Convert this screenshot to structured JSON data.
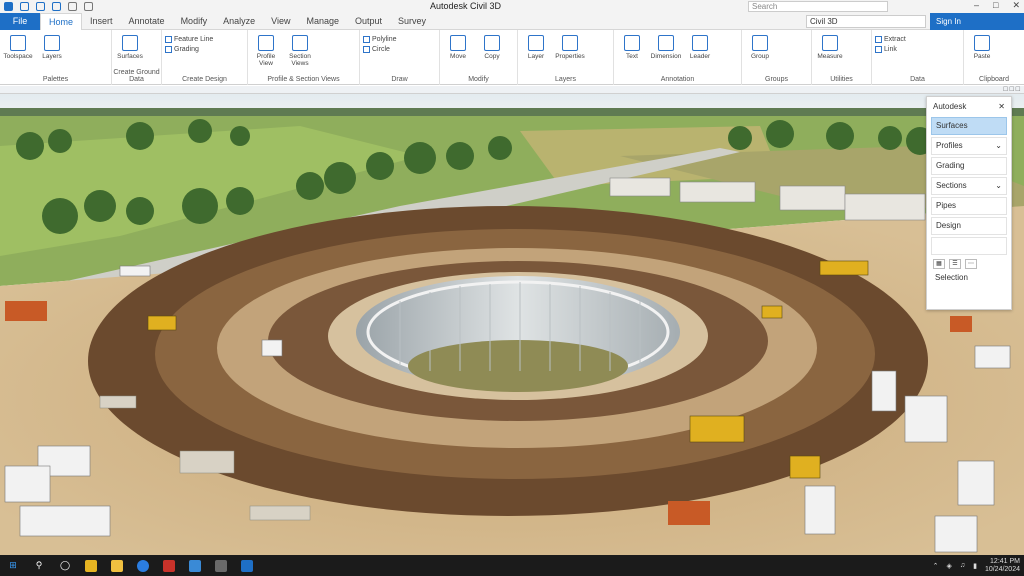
{
  "app": {
    "title": "Autodesk Civil 3D",
    "search_placeholder": "Search",
    "workspace": "Civil 3D"
  },
  "tabs": [
    {
      "label": "File"
    },
    {
      "label": "Home"
    },
    {
      "label": "Insert"
    },
    {
      "label": "Annotate"
    },
    {
      "label": "Modify"
    },
    {
      "label": "Analyze"
    },
    {
      "label": "View"
    },
    {
      "label": "Manage"
    },
    {
      "label": "Output"
    },
    {
      "label": "Survey"
    }
  ],
  "signin": "Sign In",
  "ribbon": {
    "panels": [
      {
        "label": "Palettes",
        "buttons": [
          "Toolspace",
          "Layers"
        ]
      },
      {
        "label": "Create Ground Data",
        "buttons": [
          "Surfaces"
        ]
      },
      {
        "label": "Create Design",
        "small": [
          "Feature Line",
          "Grading"
        ]
      },
      {
        "label": "Profile & Section Views",
        "buttons": [
          "Profile View",
          "Section Views"
        ]
      },
      {
        "label": "Draw",
        "small": [
          "Polyline",
          "Circle"
        ]
      },
      {
        "label": "Modify",
        "buttons": [
          "Move",
          "Copy"
        ]
      },
      {
        "label": "Layers",
        "buttons": [
          "Layer",
          "Properties"
        ]
      },
      {
        "label": "Annotation",
        "buttons": [
          "Text",
          "Dimension",
          "Leader"
        ]
      },
      {
        "label": "Groups",
        "buttons": [
          "Group"
        ]
      },
      {
        "label": "Utilities",
        "buttons": [
          "Measure"
        ]
      },
      {
        "label": "Data",
        "small": [
          "Extract",
          "Link"
        ]
      },
      {
        "label": "Clipboard",
        "buttons": [
          "Paste"
        ]
      }
    ]
  },
  "palette": {
    "title": "Autodesk",
    "items": [
      {
        "label": "Surfaces",
        "selected": true
      },
      {
        "label": "Profiles"
      },
      {
        "label": "Grading"
      },
      {
        "label": "Sections"
      },
      {
        "label": "Pipes"
      },
      {
        "label": "Design"
      }
    ],
    "footer": "Selection"
  },
  "taskbar": {
    "time": "12:41 PM",
    "date": "10/24/2024"
  },
  "colors": {
    "accent": "#1e6fc6",
    "taskbar": "#1b1b1b"
  }
}
